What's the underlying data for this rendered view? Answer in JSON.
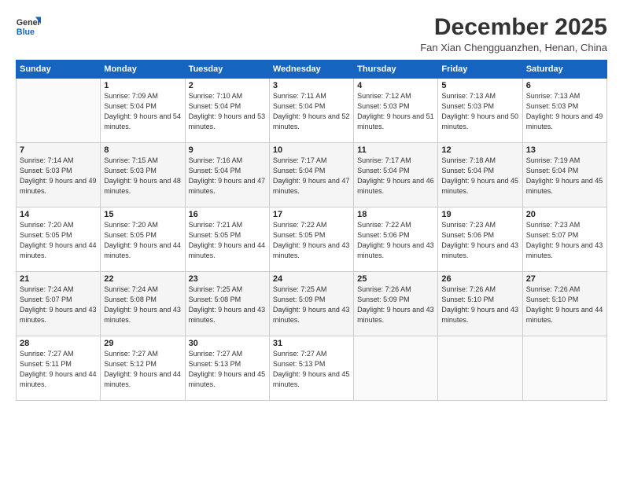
{
  "logo": {
    "general": "General",
    "blue": "Blue"
  },
  "title": "December 2025",
  "location": "Fan Xian Chengguanzhen, Henan, China",
  "headers": [
    "Sunday",
    "Monday",
    "Tuesday",
    "Wednesday",
    "Thursday",
    "Friday",
    "Saturday"
  ],
  "weeks": [
    [
      {
        "day": "",
        "sunrise": "",
        "sunset": "",
        "daylight": ""
      },
      {
        "day": "1",
        "sunrise": "Sunrise: 7:09 AM",
        "sunset": "Sunset: 5:04 PM",
        "daylight": "Daylight: 9 hours and 54 minutes."
      },
      {
        "day": "2",
        "sunrise": "Sunrise: 7:10 AM",
        "sunset": "Sunset: 5:04 PM",
        "daylight": "Daylight: 9 hours and 53 minutes."
      },
      {
        "day": "3",
        "sunrise": "Sunrise: 7:11 AM",
        "sunset": "Sunset: 5:04 PM",
        "daylight": "Daylight: 9 hours and 52 minutes."
      },
      {
        "day": "4",
        "sunrise": "Sunrise: 7:12 AM",
        "sunset": "Sunset: 5:03 PM",
        "daylight": "Daylight: 9 hours and 51 minutes."
      },
      {
        "day": "5",
        "sunrise": "Sunrise: 7:13 AM",
        "sunset": "Sunset: 5:03 PM",
        "daylight": "Daylight: 9 hours and 50 minutes."
      },
      {
        "day": "6",
        "sunrise": "Sunrise: 7:13 AM",
        "sunset": "Sunset: 5:03 PM",
        "daylight": "Daylight: 9 hours and 49 minutes."
      }
    ],
    [
      {
        "day": "7",
        "sunrise": "Sunrise: 7:14 AM",
        "sunset": "Sunset: 5:03 PM",
        "daylight": "Daylight: 9 hours and 49 minutes."
      },
      {
        "day": "8",
        "sunrise": "Sunrise: 7:15 AM",
        "sunset": "Sunset: 5:03 PM",
        "daylight": "Daylight: 9 hours and 48 minutes."
      },
      {
        "day": "9",
        "sunrise": "Sunrise: 7:16 AM",
        "sunset": "Sunset: 5:04 PM",
        "daylight": "Daylight: 9 hours and 47 minutes."
      },
      {
        "day": "10",
        "sunrise": "Sunrise: 7:17 AM",
        "sunset": "Sunset: 5:04 PM",
        "daylight": "Daylight: 9 hours and 47 minutes."
      },
      {
        "day": "11",
        "sunrise": "Sunrise: 7:17 AM",
        "sunset": "Sunset: 5:04 PM",
        "daylight": "Daylight: 9 hours and 46 minutes."
      },
      {
        "day": "12",
        "sunrise": "Sunrise: 7:18 AM",
        "sunset": "Sunset: 5:04 PM",
        "daylight": "Daylight: 9 hours and 45 minutes."
      },
      {
        "day": "13",
        "sunrise": "Sunrise: 7:19 AM",
        "sunset": "Sunset: 5:04 PM",
        "daylight": "Daylight: 9 hours and 45 minutes."
      }
    ],
    [
      {
        "day": "14",
        "sunrise": "Sunrise: 7:20 AM",
        "sunset": "Sunset: 5:05 PM",
        "daylight": "Daylight: 9 hours and 44 minutes."
      },
      {
        "day": "15",
        "sunrise": "Sunrise: 7:20 AM",
        "sunset": "Sunset: 5:05 PM",
        "daylight": "Daylight: 9 hours and 44 minutes."
      },
      {
        "day": "16",
        "sunrise": "Sunrise: 7:21 AM",
        "sunset": "Sunset: 5:05 PM",
        "daylight": "Daylight: 9 hours and 44 minutes."
      },
      {
        "day": "17",
        "sunrise": "Sunrise: 7:22 AM",
        "sunset": "Sunset: 5:05 PM",
        "daylight": "Daylight: 9 hours and 43 minutes."
      },
      {
        "day": "18",
        "sunrise": "Sunrise: 7:22 AM",
        "sunset": "Sunset: 5:06 PM",
        "daylight": "Daylight: 9 hours and 43 minutes."
      },
      {
        "day": "19",
        "sunrise": "Sunrise: 7:23 AM",
        "sunset": "Sunset: 5:06 PM",
        "daylight": "Daylight: 9 hours and 43 minutes."
      },
      {
        "day": "20",
        "sunrise": "Sunrise: 7:23 AM",
        "sunset": "Sunset: 5:07 PM",
        "daylight": "Daylight: 9 hours and 43 minutes."
      }
    ],
    [
      {
        "day": "21",
        "sunrise": "Sunrise: 7:24 AM",
        "sunset": "Sunset: 5:07 PM",
        "daylight": "Daylight: 9 hours and 43 minutes."
      },
      {
        "day": "22",
        "sunrise": "Sunrise: 7:24 AM",
        "sunset": "Sunset: 5:08 PM",
        "daylight": "Daylight: 9 hours and 43 minutes."
      },
      {
        "day": "23",
        "sunrise": "Sunrise: 7:25 AM",
        "sunset": "Sunset: 5:08 PM",
        "daylight": "Daylight: 9 hours and 43 minutes."
      },
      {
        "day": "24",
        "sunrise": "Sunrise: 7:25 AM",
        "sunset": "Sunset: 5:09 PM",
        "daylight": "Daylight: 9 hours and 43 minutes."
      },
      {
        "day": "25",
        "sunrise": "Sunrise: 7:26 AM",
        "sunset": "Sunset: 5:09 PM",
        "daylight": "Daylight: 9 hours and 43 minutes."
      },
      {
        "day": "26",
        "sunrise": "Sunrise: 7:26 AM",
        "sunset": "Sunset: 5:10 PM",
        "daylight": "Daylight: 9 hours and 43 minutes."
      },
      {
        "day": "27",
        "sunrise": "Sunrise: 7:26 AM",
        "sunset": "Sunset: 5:10 PM",
        "daylight": "Daylight: 9 hours and 44 minutes."
      }
    ],
    [
      {
        "day": "28",
        "sunrise": "Sunrise: 7:27 AM",
        "sunset": "Sunset: 5:11 PM",
        "daylight": "Daylight: 9 hours and 44 minutes."
      },
      {
        "day": "29",
        "sunrise": "Sunrise: 7:27 AM",
        "sunset": "Sunset: 5:12 PM",
        "daylight": "Daylight: 9 hours and 44 minutes."
      },
      {
        "day": "30",
        "sunrise": "Sunrise: 7:27 AM",
        "sunset": "Sunset: 5:13 PM",
        "daylight": "Daylight: 9 hours and 45 minutes."
      },
      {
        "day": "31",
        "sunrise": "Sunrise: 7:27 AM",
        "sunset": "Sunset: 5:13 PM",
        "daylight": "Daylight: 9 hours and 45 minutes."
      },
      {
        "day": "",
        "sunrise": "",
        "sunset": "",
        "daylight": ""
      },
      {
        "day": "",
        "sunrise": "",
        "sunset": "",
        "daylight": ""
      },
      {
        "day": "",
        "sunrise": "",
        "sunset": "",
        "daylight": ""
      }
    ]
  ]
}
